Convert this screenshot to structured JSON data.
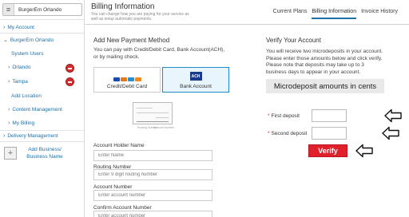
{
  "sidebar": {
    "search_icon": "hamburger-grid-icon",
    "search_value": "BurgerEm Orlando",
    "items": [
      {
        "label": "My Account"
      },
      {
        "label": "BurgerEm Orlando"
      },
      {
        "label": "System Users"
      },
      {
        "label": "Orlando"
      },
      {
        "label": "Tampa"
      },
      {
        "label": "Add Location"
      },
      {
        "label": "Content Management"
      },
      {
        "label": "My Billing"
      },
      {
        "label": "Delivery Management"
      }
    ],
    "add_business_label": "Add Business/ Business Name"
  },
  "header": {
    "title": "Billing Information",
    "subtitle": "You can change how you are paying for your service as well as setup automatic payments.",
    "tabs": [
      {
        "label": "Current Plans"
      },
      {
        "label": "Billing Information"
      },
      {
        "label": "Invoice History"
      }
    ]
  },
  "payment": {
    "title": "Add New Payment Method",
    "description": "You can pay with Credit/Debit Card, Bank Account(ACH), or by mailing check.",
    "methods": [
      {
        "label": "Credit/Debit Card"
      },
      {
        "label": "Bank Account",
        "badge": "ACH"
      }
    ],
    "check_captions": [
      "Routing Number",
      "Account Number"
    ],
    "fields": [
      {
        "label": "Account Holder Name",
        "placeholder": "Enter Name"
      },
      {
        "label": "Routing Number",
        "placeholder": "Enter 9 digit routing number"
      },
      {
        "label": "Account Number",
        "placeholder": "Enter account number"
      },
      {
        "label": "Confirm Account Number",
        "placeholder": "Enter account number"
      }
    ]
  },
  "verify": {
    "title": "Verify Your Account",
    "description": "You will receive two microdeposits in your account. Please enter those amounts below and click verify. Please note that deposits may take up to 3 business days to appear in your account.",
    "box_label": "Microdeposit amounts in cents",
    "first_label": "First deposit",
    "second_label": "Second deposit",
    "required_mark": "*",
    "button_label": "Verify"
  },
  "colors": {
    "accent": "#1e6fa8",
    "verify_button": "#e0202b",
    "ach_badge": "#1a3b8c",
    "status_badge": "#d12f2f"
  }
}
